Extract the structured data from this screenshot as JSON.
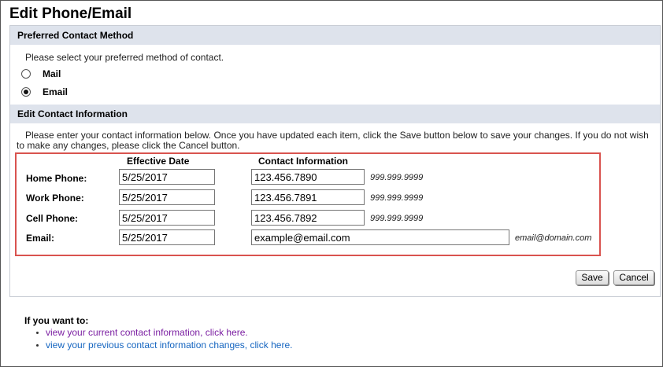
{
  "page": {
    "title": "Edit Phone/Email"
  },
  "preferred": {
    "header": "Preferred Contact Method",
    "prompt": "Please select your preferred method of contact.",
    "options": [
      {
        "label": "Mail",
        "checked": false
      },
      {
        "label": "Email",
        "checked": true
      }
    ]
  },
  "edit": {
    "header": "Edit Contact Information",
    "instructions": "Please enter your contact information below. Once you have updated each item, click the Save button below to save your changes. If you do not wish to make any changes, please click the Cancel button.",
    "columns": {
      "date": "Effective Date",
      "info": "Contact Information"
    },
    "rows": [
      {
        "label": "Home Phone:",
        "date": "5/25/2017",
        "value": "123.456.7890",
        "hint": "999.999.9999"
      },
      {
        "label": "Work Phone:",
        "date": "5/25/2017",
        "value": "123.456.7891",
        "hint": "999.999.9999"
      },
      {
        "label": "Cell Phone:",
        "date": "5/25/2017",
        "value": "123.456.7892",
        "hint": "999.999.9999"
      },
      {
        "label": "Email:",
        "date": "5/25/2017",
        "value": "example@email.com",
        "hint": "email@domain.com"
      }
    ],
    "save_label": "Save",
    "cancel_label": "Cancel"
  },
  "footer": {
    "title": "If you want to:",
    "links": [
      "view your current contact information, click here.",
      "view your previous contact information changes, click here."
    ]
  },
  "colors": {
    "header_bg": "#dee3ec",
    "highlight": "#d9534f",
    "link": "#1565c0",
    "visited_link": "#7b1fa2"
  }
}
